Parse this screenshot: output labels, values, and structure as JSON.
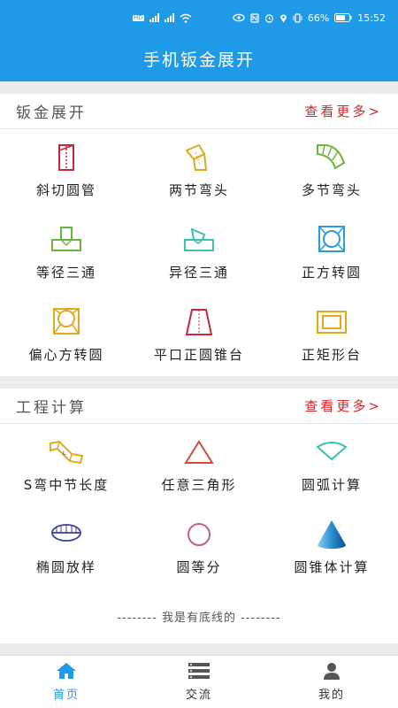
{
  "status_bar": {
    "battery": "66%",
    "time": "15:52"
  },
  "app_title": "手机钣金展开",
  "sections": [
    {
      "title": "钣金展开",
      "more": "查看更多>",
      "items": [
        {
          "label": "斜切圆管",
          "icon": "oblique-cut-pipe-icon"
        },
        {
          "label": "两节弯头",
          "icon": "two-section-elbow-icon"
        },
        {
          "label": "多节弯头",
          "icon": "multi-section-elbow-icon"
        },
        {
          "label": "等径三通",
          "icon": "equal-tee-icon"
        },
        {
          "label": "异径三通",
          "icon": "reducing-tee-icon"
        },
        {
          "label": "正方转圆",
          "icon": "square-to-round-icon"
        },
        {
          "label": "偏心方转圆",
          "icon": "eccentric-square-to-round-icon"
        },
        {
          "label": "平口正圆锥台",
          "icon": "frustum-cone-icon"
        },
        {
          "label": "正矩形台",
          "icon": "rectangular-frustum-icon"
        }
      ]
    },
    {
      "title": "工程计算",
      "more": "查看更多>",
      "items": [
        {
          "label": "S弯中节长度",
          "icon": "s-bend-icon"
        },
        {
          "label": "任意三角形",
          "icon": "triangle-icon"
        },
        {
          "label": "圆弧计算",
          "icon": "arc-icon"
        },
        {
          "label": "椭圆放样",
          "icon": "ellipse-icon"
        },
        {
          "label": "圆等分",
          "icon": "circle-icon"
        },
        {
          "label": "圆锥体计算",
          "icon": "cone-icon"
        }
      ]
    }
  ],
  "footer_text": "-------- 我是有底线的 --------",
  "bottom_nav": [
    {
      "label": "首页",
      "icon": "home-icon",
      "active": true
    },
    {
      "label": "交流",
      "icon": "list-icon",
      "active": false
    },
    {
      "label": "我的",
      "icon": "user-icon",
      "active": false
    }
  ],
  "colors": {
    "primary": "#1e9ae6",
    "more_link": "#d6242b"
  }
}
